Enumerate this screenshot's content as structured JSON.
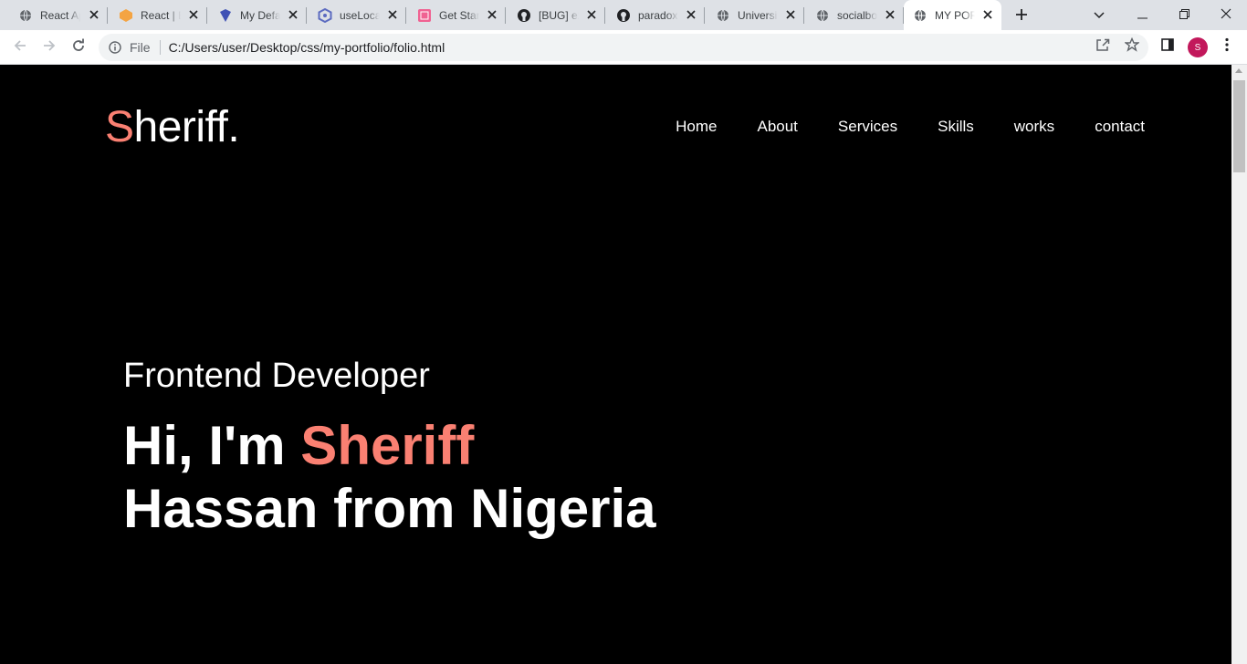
{
  "browser": {
    "tabs": [
      {
        "title": "React App",
        "icon": "globe-icon"
      },
      {
        "title": "React | Bootstrap",
        "icon": "react-bootstrap-icon"
      },
      {
        "title": "My Default",
        "icon": "shield-icon"
      },
      {
        "title": "useLocation",
        "icon": "hexagon-icon"
      },
      {
        "title": "Get Started",
        "icon": "app-icon"
      },
      {
        "title": "[BUG] ex",
        "icon": "github-icon"
      },
      {
        "title": "paradox",
        "icon": "github-icon"
      },
      {
        "title": "University",
        "icon": "globe-icon"
      },
      {
        "title": "socialbook",
        "icon": "globe-icon"
      },
      {
        "title": "MY PORTFOLIO",
        "icon": "globe-icon",
        "active": true
      }
    ],
    "address": {
      "scheme_label": "File",
      "url": "C:/Users/user/Desktop/css/my-portfolio/folio.html"
    },
    "profile_initial": "S",
    "profile_color": "#c2185b"
  },
  "site": {
    "logo_initial": "S",
    "logo_rest": "heriff.",
    "nav": [
      "Home",
      "About",
      "Services",
      "Skills",
      "works",
      "contact"
    ],
    "hero": {
      "role": "Frontend Developer",
      "greeting": "Hi, I'm ",
      "name_accent": "Sheriff",
      "rest": "Hassan from Nigeria"
    },
    "accent_color": "#fa8072",
    "background_color": "#000000"
  }
}
